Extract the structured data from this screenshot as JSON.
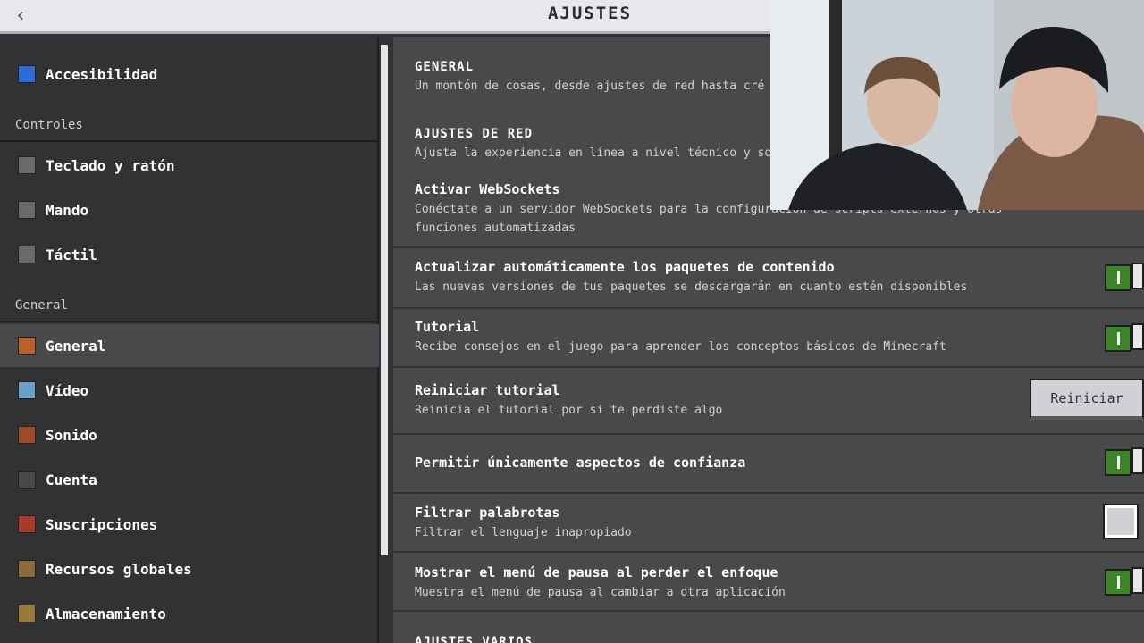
{
  "header": {
    "title": "AJUSTES",
    "back_icon": "chevron-left-icon"
  },
  "sidebar": {
    "top_items": [
      {
        "label": "Accesibilidad",
        "icon": "accessibility-icon",
        "color": "#2e6bd6"
      }
    ],
    "controls_header": "Controles",
    "controls_items": [
      {
        "label": "Teclado y ratón",
        "icon": "keyboard-mouse-icon",
        "color": "#6a6a6a"
      },
      {
        "label": "Mando",
        "icon": "gamepad-icon",
        "color": "#6a6a6a"
      },
      {
        "label": "Táctil",
        "icon": "touch-icon",
        "color": "#6a6a6a"
      }
    ],
    "general_header": "General",
    "general_items": [
      {
        "label": "General",
        "icon": "general-gear-icon",
        "color": "#b8612b",
        "active": true
      },
      {
        "label": "Vídeo",
        "icon": "video-landscape-icon",
        "color": "#6aa0c8"
      },
      {
        "label": "Sonido",
        "icon": "note-block-icon",
        "color": "#9b4a2a"
      },
      {
        "label": "Cuenta",
        "icon": "account-icon",
        "color": "#4a4a4a"
      },
      {
        "label": "Suscripciones",
        "icon": "subscriptions-icon",
        "color": "#a83a2a"
      },
      {
        "label": "Recursos globales",
        "icon": "global-resources-icon",
        "color": "#8a6a3a"
      },
      {
        "label": "Almacenamiento",
        "icon": "storage-chest-icon",
        "color": "#9a7a3a"
      }
    ]
  },
  "main": {
    "general": {
      "title": "GENERAL",
      "desc": "Un montón de cosas, desde ajustes de red hasta cré"
    },
    "network": {
      "title": "AJUSTES DE RED",
      "desc": "Ajusta la experiencia en línea a nivel técnico y socia"
    },
    "rows": {
      "websockets": {
        "title": "Activar WebSockets",
        "desc1": "Conéctate a un servidor WebSockets para la configuración de scripts externos y otras",
        "desc2": "funciones automatizadas"
      },
      "auto_update": {
        "title": "Actualizar automáticamente los paquetes de contenido",
        "desc": "Las nuevas versiones de tus paquetes se descargarán en cuanto estén disponibles"
      },
      "tutorial": {
        "title": "Tutorial",
        "desc": "Recibe consejos en el juego para aprender los conceptos básicos de Minecraft"
      },
      "reset_tutorial": {
        "title": "Reiniciar tutorial",
        "desc": "Reinicia el tutorial por si te perdiste algo",
        "button": "Reiniciar"
      },
      "trusted_skins": {
        "title": "Permitir únicamente aspectos de confianza"
      },
      "profanity": {
        "title": "Filtrar palabrotas",
        "desc": "Filtrar el lenguaje inapropiado"
      },
      "pause_menu": {
        "title": "Mostrar el menú de pausa al perder el enfoque",
        "desc": "Muestra el menú de pausa al cambiar a otra aplicación"
      }
    },
    "next_section": {
      "title": "AJUSTES VARIOS"
    }
  },
  "colors": {
    "toggle_on": "#3c8527",
    "panel": "#48494a",
    "sidebar": "#313233",
    "header": "#e6e8eb"
  }
}
